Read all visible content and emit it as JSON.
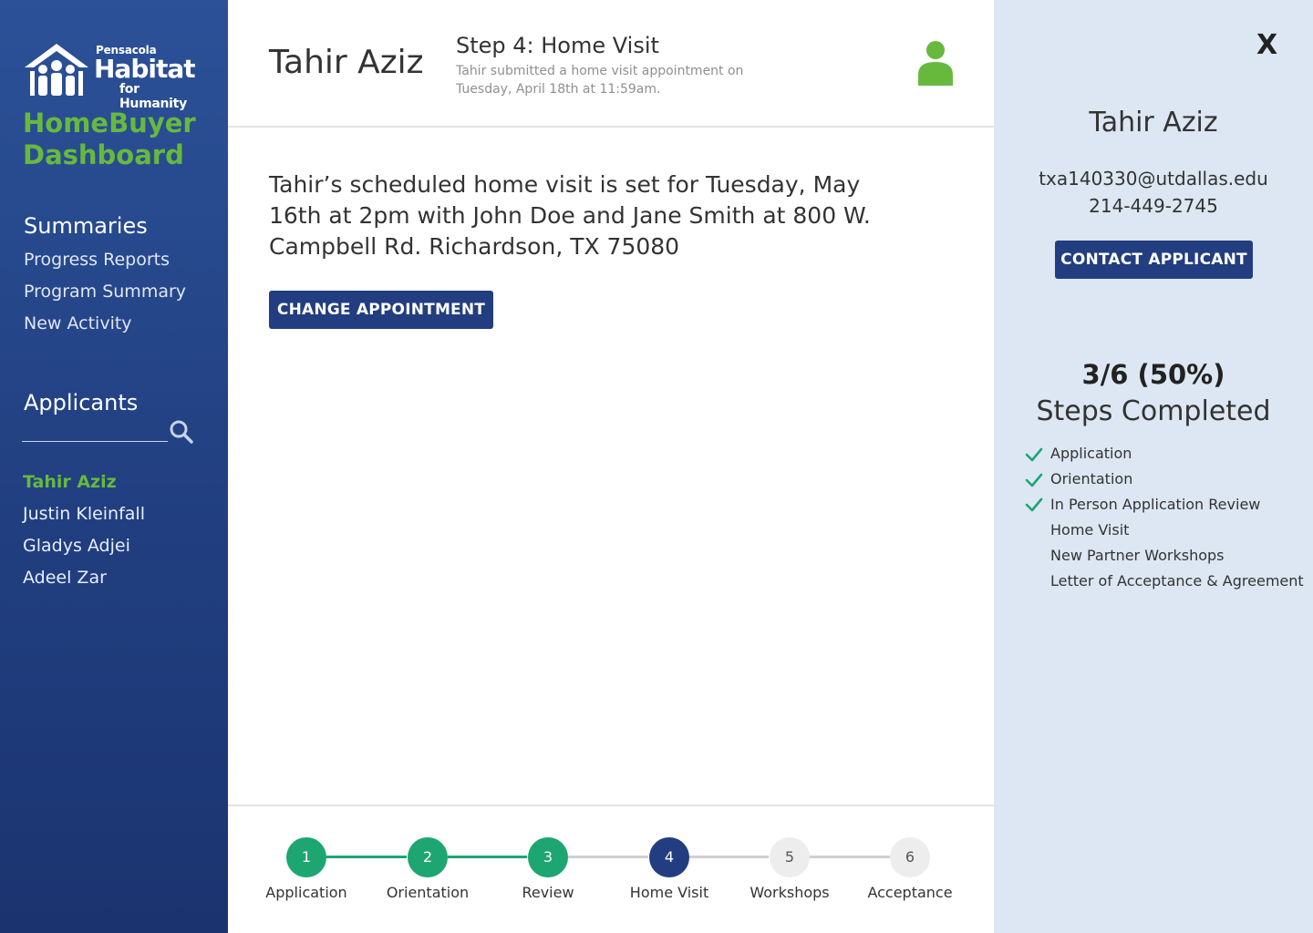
{
  "brand": {
    "org_small": "Pensacola",
    "org_big": "Habitat",
    "org_sub": "for Humanity",
    "dashboard_line1": "HomeBuyer",
    "dashboard_line2": "Dashboard"
  },
  "sidebar": {
    "summaries_heading": "Summaries",
    "summaries": [
      {
        "label": "Progress Reports"
      },
      {
        "label": "Program Summary"
      },
      {
        "label": "New Activity"
      }
    ],
    "applicants_heading": "Applicants",
    "search_placeholder": "",
    "applicants": [
      {
        "label": "Tahir Aziz",
        "active": true
      },
      {
        "label": "Justin Kleinfall",
        "active": false
      },
      {
        "label": "Gladys Adjei",
        "active": false
      },
      {
        "label": "Adeel Zar",
        "active": false
      }
    ]
  },
  "header": {
    "applicant_name": "Tahir Aziz",
    "step_title": "Step 4: Home Visit",
    "step_subtitle": "Tahir submitted a home visit appointment on Tuesday, April 18th at 11:59am."
  },
  "main": {
    "visit_text": "Tahir’s scheduled home visit is set for Tuesday, May 16th at 2pm with John Doe and Jane Smith at 800 W. Campbell Rd. Richardson, TX 75080",
    "change_button": "CHANGE APPOINTMENT"
  },
  "progress": {
    "steps": [
      {
        "number": "1",
        "label": "Application",
        "status": "done"
      },
      {
        "number": "2",
        "label": "Orientation",
        "status": "done"
      },
      {
        "number": "3",
        "label": "Review",
        "status": "done"
      },
      {
        "number": "4",
        "label": "Home Visit",
        "status": "current"
      },
      {
        "number": "5",
        "label": "Workshops",
        "status": "todo"
      },
      {
        "number": "6",
        "label": "Acceptance",
        "status": "todo"
      }
    ]
  },
  "panel": {
    "close_label": "X",
    "name": "Tahir Aziz",
    "email": "txa140330@utdallas.edu",
    "phone": "214-449-2745",
    "contact_button": "CONTACT APPLICANT",
    "completed_count": "3/6 (50%)",
    "completed_label": "Steps Completed",
    "checklist": [
      {
        "label": "Application",
        "done": true
      },
      {
        "label": "Orientation",
        "done": true
      },
      {
        "label": "In Person Application Review",
        "done": true
      },
      {
        "label": "Home Visit",
        "done": false
      },
      {
        "label": "New Partner Workshops",
        "done": false
      },
      {
        "label": "Letter of Acceptance & Agreement",
        "done": false
      }
    ]
  },
  "colors": {
    "brand_blue": "#223e80",
    "brand_green": "#67b93e",
    "step_done": "#1ea672",
    "panel_bg": "#dce7f3"
  }
}
